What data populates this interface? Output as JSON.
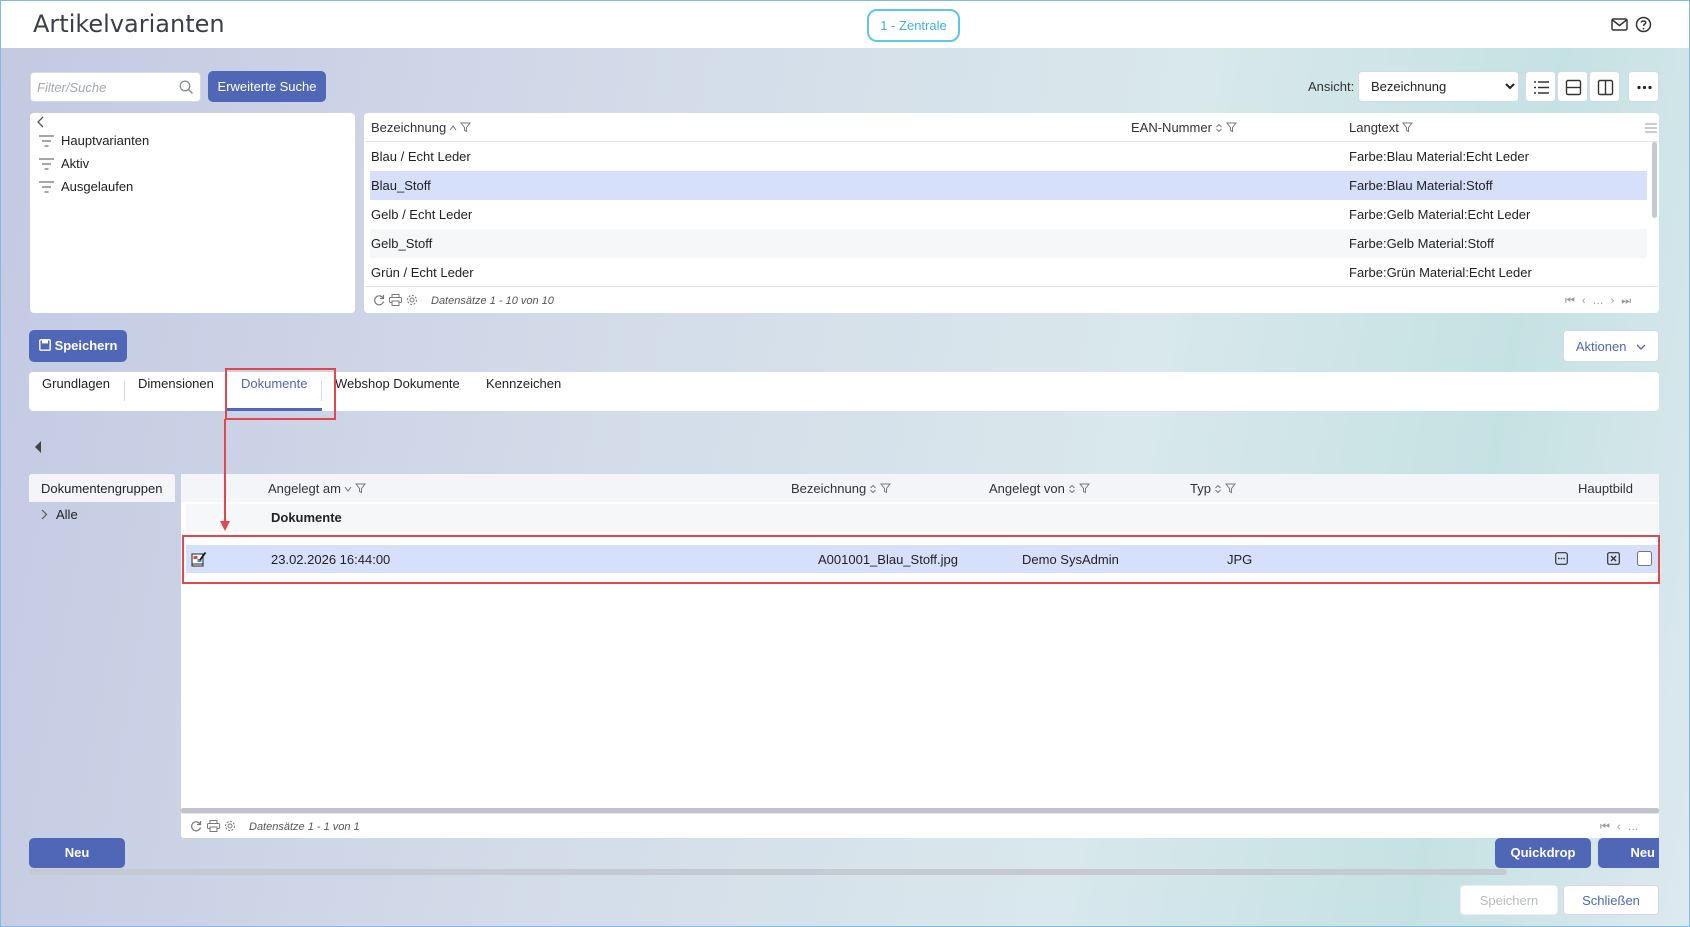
{
  "app": {
    "title": "Artikelvarianten",
    "branch": "1 - Zentrale"
  },
  "icons": {
    "mail": "mail-icon",
    "help": "help-icon"
  },
  "search": {
    "placeholder": "Filter/Suche",
    "advanced_label": "Erweiterte Suche"
  },
  "view": {
    "label": "Ansicht:",
    "selected": "Bezeichnung"
  },
  "filters": {
    "items": [
      {
        "label": "Hauptvarianten"
      },
      {
        "label": "Aktiv"
      },
      {
        "label": "Ausgelaufen"
      }
    ]
  },
  "variants_grid": {
    "columns": {
      "bezeichnung": "Bezeichnung",
      "ean": "EAN-Nummer",
      "langtext": "Langtext"
    },
    "rows": [
      {
        "bezeichnung": "Blau / Echt Leder",
        "ean": "",
        "langtext": "Farbe:Blau Material:Echt Leder"
      },
      {
        "bezeichnung": "Blau_Stoff",
        "ean": "",
        "langtext": "Farbe:Blau Material:Stoff"
      },
      {
        "bezeichnung": "Gelb / Echt Leder",
        "ean": "",
        "langtext": "Farbe:Gelb Material:Echt Leder"
      },
      {
        "bezeichnung": "Gelb_Stoff",
        "ean": "",
        "langtext": "Farbe:Gelb Material:Stoff"
      },
      {
        "bezeichnung": "Grün / Echt Leder",
        "ean": "",
        "langtext": "Farbe:Grün Material:Echt Leder"
      }
    ],
    "selected_row": 1,
    "footer": "Datensätze 1 - 10 von 10"
  },
  "toolbar": {
    "save_label": "Speichern",
    "actions_label": "Aktionen"
  },
  "tabs": [
    {
      "label": "Grundlagen"
    },
    {
      "label": "Dimensionen"
    },
    {
      "label": "Dokumente"
    },
    {
      "label": "Webshop Dokumente"
    },
    {
      "label": "Kennzeichen"
    }
  ],
  "active_tab": 2,
  "doc_groups": {
    "title": "Dokumentengruppen",
    "items": [
      {
        "label": "Alle"
      }
    ]
  },
  "documents_grid": {
    "columns": {
      "angelegt_am": "Angelegt am",
      "bezeichnung": "Bezeichnung",
      "angelegt_von": "Angelegt von",
      "typ": "Typ",
      "hauptbild": "Hauptbild"
    },
    "group_label": "Dokumente",
    "rows": [
      {
        "angelegt_am": "23.02.2026 16:44:00",
        "bezeichnung": "A001001_Blau_Stoff.jpg",
        "angelegt_von": "Demo SysAdmin",
        "typ": "JPG",
        "hauptbild": false
      }
    ],
    "footer": "Datensätze 1 - 1 von 1"
  },
  "bottom": {
    "neu_left": "Neu",
    "quickdrop": "Quickdrop",
    "neu_right": "Neu",
    "save_disabled": "Speichern",
    "close": "Schließen"
  },
  "colors": {
    "primary": "#4f67b6",
    "selection": "#d7e0fb",
    "highlight": "#e2474b",
    "branch": "#5fc6ea"
  }
}
